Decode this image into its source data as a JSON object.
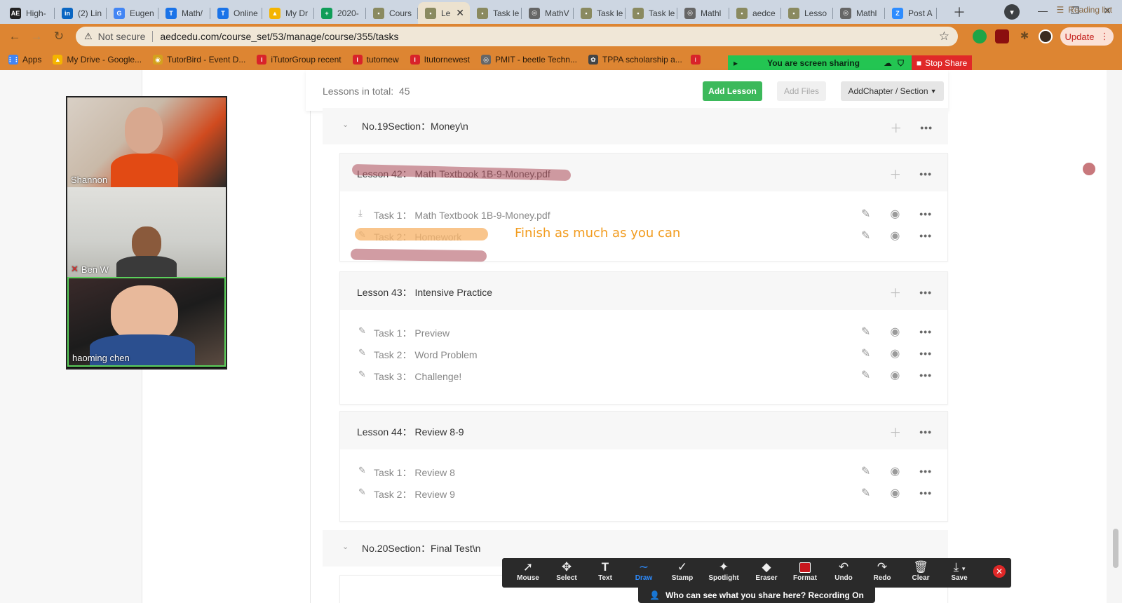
{
  "browser": {
    "tabs": [
      {
        "label": "High-",
        "favicon": "AE",
        "color": "#222222"
      },
      {
        "label": "(2) Lin",
        "favicon": "in",
        "color": "#0a66c2"
      },
      {
        "label": "Eugen",
        "favicon": "G",
        "color": "#4285f4"
      },
      {
        "label": "Math/",
        "favicon": "T",
        "color": "#1a73e8"
      },
      {
        "label": "Online",
        "favicon": "T",
        "color": "#1a73e8"
      },
      {
        "label": "My Dr",
        "favicon": "▲",
        "color": "#f4b400"
      },
      {
        "label": "2020-",
        "favicon": "+",
        "color": "#0f9d58"
      },
      {
        "label": "Cours",
        "favicon": "▪",
        "color": "#8a8a60"
      },
      {
        "label": "Le",
        "favicon": "▪",
        "color": "#8a8a60"
      },
      {
        "label": "Task le",
        "favicon": "▪",
        "color": "#8a8a60"
      },
      {
        "label": "MathV",
        "favicon": "◎",
        "color": "#666666"
      },
      {
        "label": "Task le",
        "favicon": "▪",
        "color": "#8a8a60"
      },
      {
        "label": "Task le",
        "favicon": "▪",
        "color": "#8a8a60"
      },
      {
        "label": "Mathl",
        "favicon": "◎",
        "color": "#666666"
      },
      {
        "label": "aedce",
        "favicon": "▪",
        "color": "#8a8a60"
      },
      {
        "label": "Lesso",
        "favicon": "▪",
        "color": "#8a8a60"
      },
      {
        "label": "Mathl",
        "favicon": "◎",
        "color": "#666666"
      },
      {
        "label": "Post A",
        "favicon": "Z",
        "color": "#2d8cff"
      }
    ],
    "active_tab_index": 8,
    "omnibox": {
      "security": "Not secure",
      "url": "aedcedu.com/course_set/53/manage/course/355/tasks"
    },
    "update_label": "Update",
    "bookmarks": [
      {
        "label": "Apps",
        "icon": "apps-grid",
        "color": "#4285f4"
      },
      {
        "label": "My Drive - Google...",
        "icon": "drive-icon",
        "color": "#f4b400"
      },
      {
        "label": "TutorBird - Event D...",
        "icon": "tutorbird-icon",
        "color": "#d4a11e"
      },
      {
        "label": "iTutorGroup recent",
        "icon": "itutor-icon",
        "color": "#d8232a"
      },
      {
        "label": "tutornew",
        "icon": "itutor-icon",
        "color": "#d8232a"
      },
      {
        "label": "Itutornewest",
        "icon": "itutor-icon",
        "color": "#d8232a"
      },
      {
        "label": "PMIT - beetle Techn...",
        "icon": "globe-icon",
        "color": "#666666"
      },
      {
        "label": "TPPA scholarship a...",
        "icon": "tppa-icon",
        "color": "#444444"
      }
    ],
    "reading_list": "Reading list"
  },
  "screen_share": {
    "status": "You are screen sharing",
    "stop_label": "Stop Share"
  },
  "course": {
    "lessons_total_label": "Lessons in total:",
    "lessons_total": "45",
    "buttons": {
      "add_lesson": "Add Lesson",
      "add_files": "Add Files",
      "add_chapter": "AddChapter / Section"
    },
    "sections": [
      {
        "title": "No.19Section：Money\\n"
      },
      {
        "title": "No.20Section：Final Test\\n"
      }
    ],
    "lessons": [
      {
        "title": "Lesson 42：  Math Textbook 1B-9-Money.pdf",
        "tasks": [
          {
            "label": "Task 1：  Math Textbook 1B-9-Money.pdf",
            "icon": "download-icon"
          },
          {
            "label": "Task 2：  Homework",
            "icon": "pencil-icon"
          }
        ]
      },
      {
        "title": "Lesson 43：  Intensive Practice",
        "tasks": [
          {
            "label": "Task 1：  Preview",
            "icon": "pencil-icon"
          },
          {
            "label": "Task 2：  Word Problem",
            "icon": "pencil-icon"
          },
          {
            "label": "Task 3：  Challenge!",
            "icon": "pencil-icon"
          }
        ]
      },
      {
        "title": "Lesson 44：  Review 8-9",
        "tasks": [
          {
            "label": "Task 1：  Review 8",
            "icon": "pencil-icon"
          },
          {
            "label": "Task 2：  Review 9",
            "icon": "pencil-icon"
          }
        ]
      }
    ]
  },
  "annotation_text": "Finish as much as you can",
  "participants": [
    {
      "name": "Shannon",
      "muted": false
    },
    {
      "name": "Ben W",
      "muted": true
    },
    {
      "name": "haoming   chen",
      "muted": false
    }
  ],
  "annotate_tools": [
    "Mouse",
    "Select",
    "Text",
    "Draw",
    "Stamp",
    "Spotlight",
    "Eraser",
    "Format",
    "Undo",
    "Redo",
    "Clear",
    "Save"
  ],
  "annotate_active_tool": "Draw",
  "recording_text": "Who can see what you share here? Recording On",
  "colors": {
    "brand_green": "#3cb95b",
    "highlight_red": "#b4606a",
    "highlight_orange": "#f7b56b",
    "annotation_orange": "#f29c1f",
    "chrome_orange": "#dd8532",
    "zoom_blue": "#2d8cff"
  }
}
